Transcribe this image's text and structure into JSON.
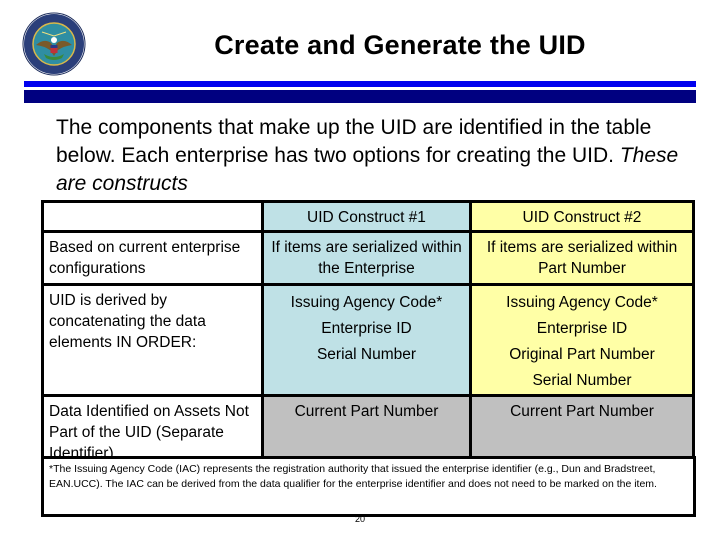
{
  "header": {
    "logo": "department-of-defense-seal",
    "title": "Create and Generate the UID",
    "accent_colors": {
      "light_bar": "#0000ee",
      "dark_bar": "#000080"
    }
  },
  "intro": {
    "text": "The components that make up the UID are identified in the table below.  Each enterprise has two options for creating the UID. ",
    "emphasis": "These are constructs"
  },
  "table": {
    "columns": [
      "",
      "UID Construct #1",
      "UID Construct #2"
    ],
    "column_colors": {
      "construct1": "#bfe1e6",
      "construct2": "#ffffa6",
      "separate": "#c0c0c0"
    },
    "rows": [
      {
        "label": "Based on current enterprise configurations",
        "construct1": [
          "If items are serialized within the Enterprise"
        ],
        "construct2": [
          "If items are serialized within Part Number"
        ]
      },
      {
        "label": "UID is derived by concatenating the data elements IN ORDER:",
        "construct1": [
          "Issuing Agency Code*",
          "Enterprise ID",
          "Serial Number"
        ],
        "construct2": [
          "Issuing Agency Code*",
          "Enterprise ID",
          "Original Part Number",
          "Serial Number"
        ]
      },
      {
        "label": "Data Identified on Assets Not Part of the UID (Separate Identifier)",
        "construct1": [
          "Current Part Number"
        ],
        "construct2": [
          "Current Part Number"
        ]
      }
    ]
  },
  "footnote": "*The Issuing Agency Code (IAC) represents the registration authority that issued the enterprise identifier (e.g., Dun and Bradstreet,  EAN.UCC).  The IAC can be derived from the data qualifier for the enterprise identifier and does not need to be marked on the item.",
  "page_number": "20"
}
